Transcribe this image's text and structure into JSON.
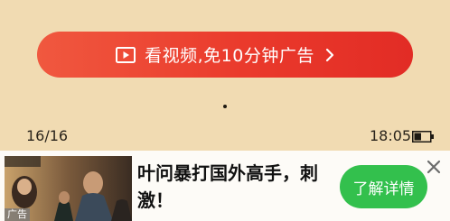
{
  "reward_button": {
    "label": "看视频,免10分钟广告",
    "icon": "play-video-icon",
    "arrow_icon": "chevron-right-icon"
  },
  "status": {
    "page_counter": "16/16",
    "time": "18:05",
    "battery_icon": "battery-icon"
  },
  "ad": {
    "tag": "广告",
    "headline": "叶问暴打国外高手，刺激！",
    "cta_label": "了解详情",
    "close_icon": "close-icon",
    "thumbnail_alt": "movie-poster"
  },
  "colors": {
    "background": "#f1dbb2",
    "button_red": "#e8392b",
    "cta_green": "#33c04d"
  }
}
